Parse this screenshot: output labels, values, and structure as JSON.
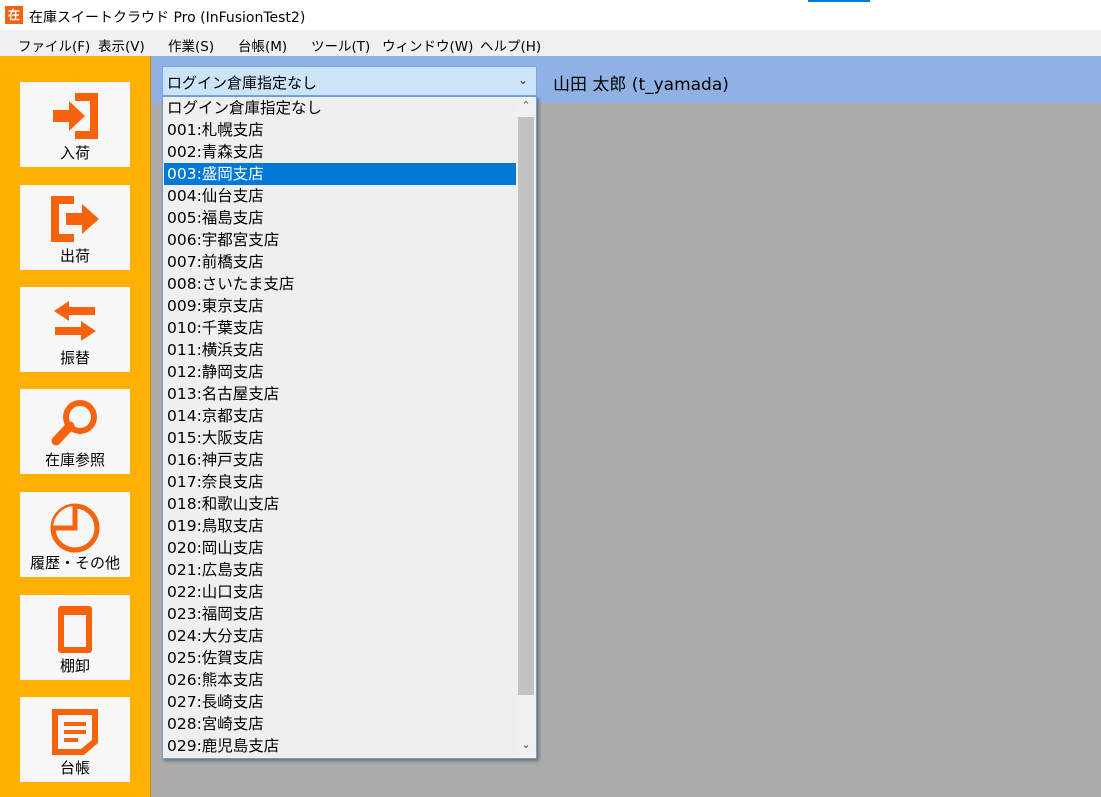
{
  "window": {
    "title": "在庫スイートクラウド Pro (InFusionTest2)",
    "icon_char": "在"
  },
  "menu": [
    "ファイル(F)",
    "表示(V)",
    "作業(S)",
    "台帳(M)",
    "ツール(T)",
    "ウィンドウ(W)",
    "ヘルプ(H)"
  ],
  "sidebar": [
    {
      "label": "入荷",
      "icon": "arrival-icon"
    },
    {
      "label": "出荷",
      "icon": "shipment-icon"
    },
    {
      "label": "振替",
      "icon": "transfer-icon"
    },
    {
      "label": "在庫参照",
      "icon": "search-icon"
    },
    {
      "label": "履歴・その他",
      "icon": "history-icon"
    },
    {
      "label": "棚卸",
      "icon": "stocktake-icon"
    },
    {
      "label": "台帳",
      "icon": "ledger-icon"
    }
  ],
  "warehouse_select": {
    "value": "ログイン倉庫指定なし",
    "selected_index": 3,
    "options": [
      "ログイン倉庫指定なし",
      "001:札幌支店",
      "002:青森支店",
      "003:盛岡支店",
      "004:仙台支店",
      "005:福島支店",
      "006:宇都宮支店",
      "007:前橋支店",
      "008:さいたま支店",
      "009:東京支店",
      "010:千葉支店",
      "011:横浜支店",
      "012:静岡支店",
      "013:名古屋支店",
      "014:京都支店",
      "015:大阪支店",
      "016:神戸支店",
      "017:奈良支店",
      "018:和歌山支店",
      "019:鳥取支店",
      "020:岡山支店",
      "021:広島支店",
      "022:山口支店",
      "023:福岡支店",
      "024:大分支店",
      "025:佐賀支店",
      "026:熊本支店",
      "027:長崎支店",
      "028:宮崎支店",
      "029:鹿児島支店"
    ]
  },
  "user": {
    "display": "山田 太郎 (t_yamada)"
  },
  "colors": {
    "accent": "#ffb000",
    "icon": "#f7630c",
    "selection": "#0078d7",
    "band": "#8fb1e3"
  }
}
